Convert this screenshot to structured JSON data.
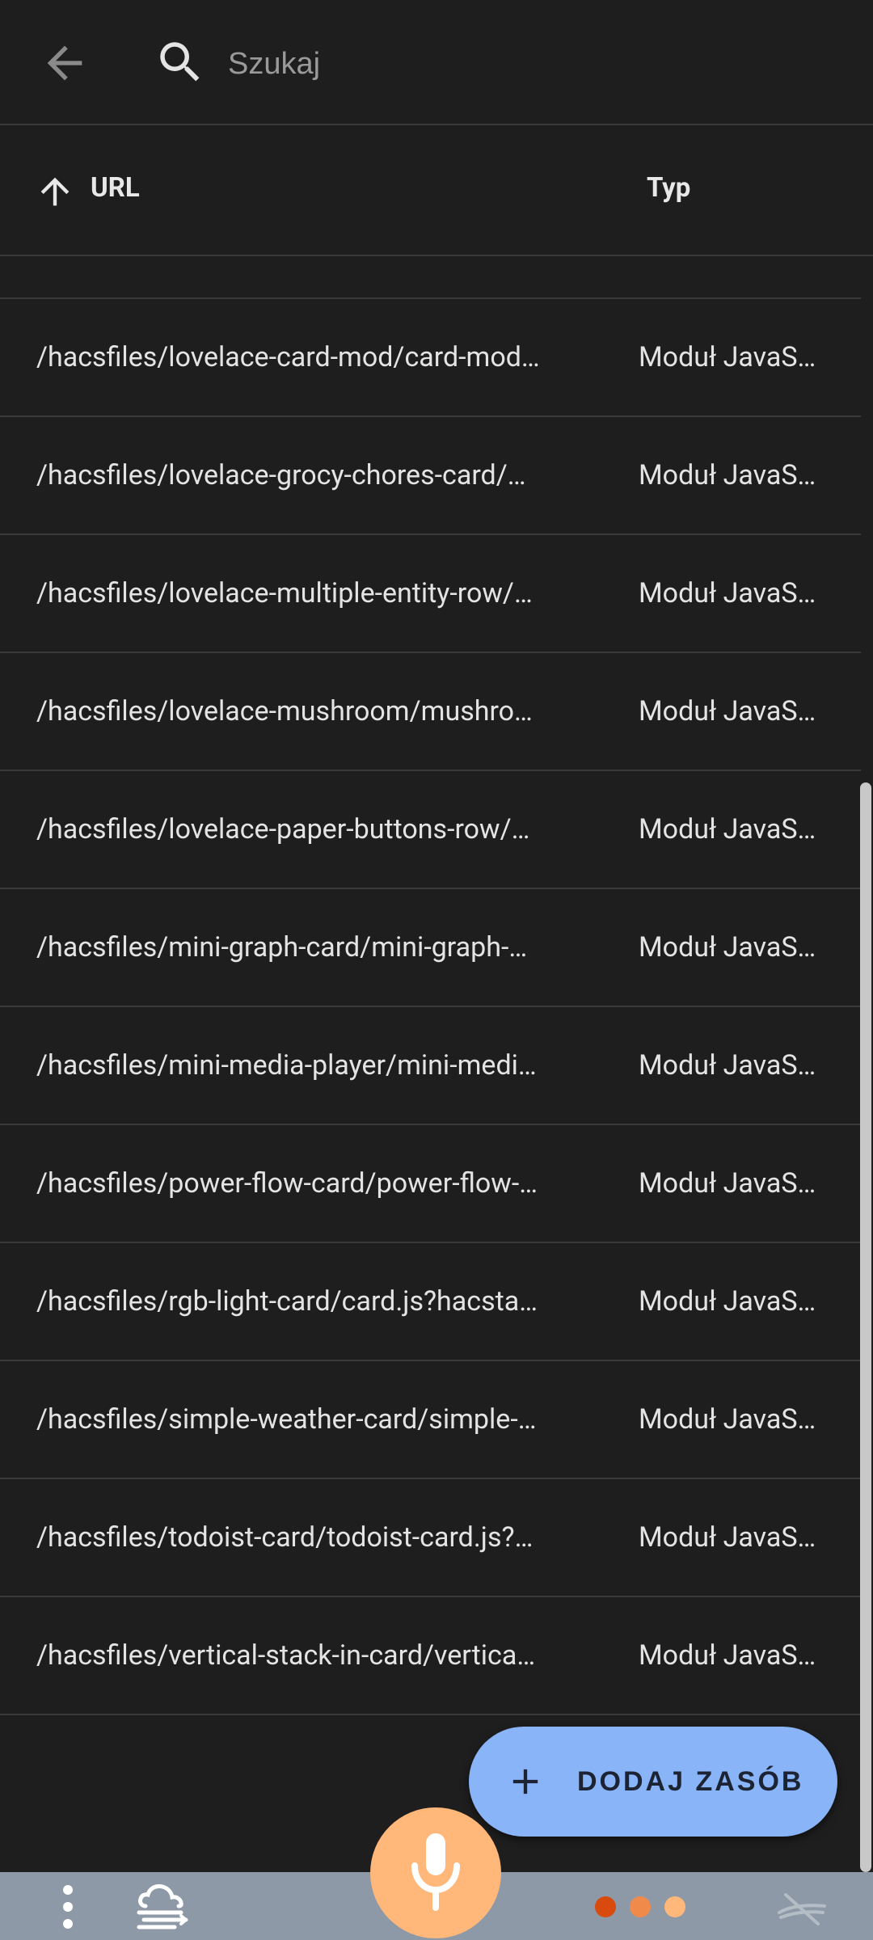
{
  "search": {
    "placeholder": "Szukaj",
    "value": ""
  },
  "table": {
    "columns": {
      "url": "URL",
      "type": "Typ"
    },
    "sort": "ascending",
    "rows": [
      {
        "url": "/hacsfiles/lovelace-card-mod/card-mod…",
        "type": "Moduł JavaS…"
      },
      {
        "url": "/hacsfiles/lovelace-grocy-chores-card/…",
        "type": "Moduł JavaS…"
      },
      {
        "url": "/hacsfiles/lovelace-multiple-entity-row/…",
        "type": "Moduł JavaS…"
      },
      {
        "url": "/hacsfiles/lovelace-mushroom/mushro…",
        "type": "Moduł JavaS…"
      },
      {
        "url": "/hacsfiles/lovelace-paper-buttons-row/…",
        "type": "Moduł JavaS…"
      },
      {
        "url": "/hacsfiles/mini-graph-card/mini-graph-…",
        "type": "Moduł JavaS…"
      },
      {
        "url": "/hacsfiles/mini-media-player/mini-medi…",
        "type": "Moduł JavaS…"
      },
      {
        "url": "/hacsfiles/power-flow-card/power-flow-…",
        "type": "Moduł JavaS…"
      },
      {
        "url": "/hacsfiles/rgb-light-card/card.js?hacsta…",
        "type": "Moduł JavaS…"
      },
      {
        "url": "/hacsfiles/simple-weather-card/simple-…",
        "type": "Moduł JavaS…"
      },
      {
        "url": "/hacsfiles/todoist-card/todoist-card.js?…",
        "type": "Moduł JavaS…"
      },
      {
        "url": "/hacsfiles/vertical-stack-in-card/vertica…",
        "type": "Moduł JavaS…"
      }
    ]
  },
  "fab": {
    "label": "DODAJ ZASÓB",
    "icon": "plus-icon"
  },
  "bottombar": {
    "icons": [
      "menu-dots-icon",
      "weather-icon",
      "mic-icon",
      "status-dots-icon",
      "sync-off-icon"
    ]
  },
  "colors": {
    "background": "#1e1e1f",
    "divider": "#3a3a3b",
    "fab": "#8ab4f8",
    "mic": "#ffb77a",
    "bottombar": "#8d99a6",
    "dot1": "#d84a0e",
    "dot2": "#f08a4b",
    "dot3": "#ffb77a"
  }
}
